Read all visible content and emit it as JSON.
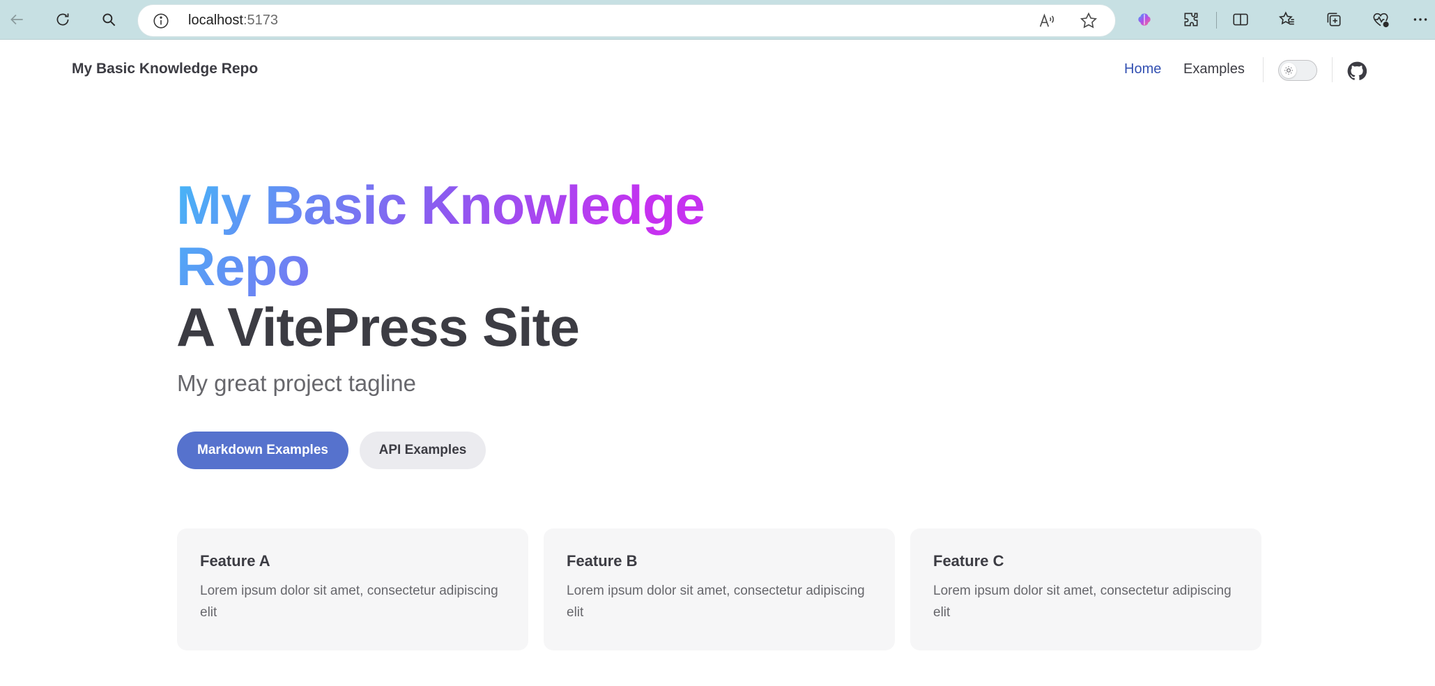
{
  "browser": {
    "url_host": "localhost",
    "url_port": ":5173",
    "icons": [
      "back-icon",
      "refresh-icon",
      "search-icon",
      "info-icon",
      "read-aloud-icon",
      "favorite-star-icon",
      "copilot-icon",
      "extensions-icon",
      "split-screen-icon",
      "favorites-icon",
      "collections-icon",
      "browser-essentials-icon",
      "more-icon"
    ]
  },
  "nav": {
    "site_title": "My Basic Knowledge Repo",
    "links": [
      {
        "label": "Home",
        "active": true
      },
      {
        "label": "Examples",
        "active": false
      }
    ]
  },
  "hero": {
    "name": "My Basic Knowledge Repo",
    "text": "A VitePress Site",
    "tagline": "My great project tagline",
    "actions": [
      {
        "label": "Markdown Examples",
        "theme": "brand"
      },
      {
        "label": "API Examples",
        "theme": "alt"
      }
    ]
  },
  "features": [
    {
      "title": "Feature A",
      "details": "Lorem ipsum dolor sit amet, consectetur adipiscing elit"
    },
    {
      "title": "Feature B",
      "details": "Lorem ipsum dolor sit amet, consectetur adipiscing elit"
    },
    {
      "title": "Feature C",
      "details": "Lorem ipsum dolor sit amet, consectetur adipiscing elit"
    }
  ],
  "colors": {
    "brand": "#5672cd",
    "nav_active": "#3451b2",
    "text": "#3c3c43",
    "muted": "#67676c",
    "card_bg": "#f6f6f7",
    "chrome_bg": "#c7e0e3",
    "gradient": [
      "#46b6f7",
      "#8a5cf0",
      "#c631f0"
    ]
  }
}
